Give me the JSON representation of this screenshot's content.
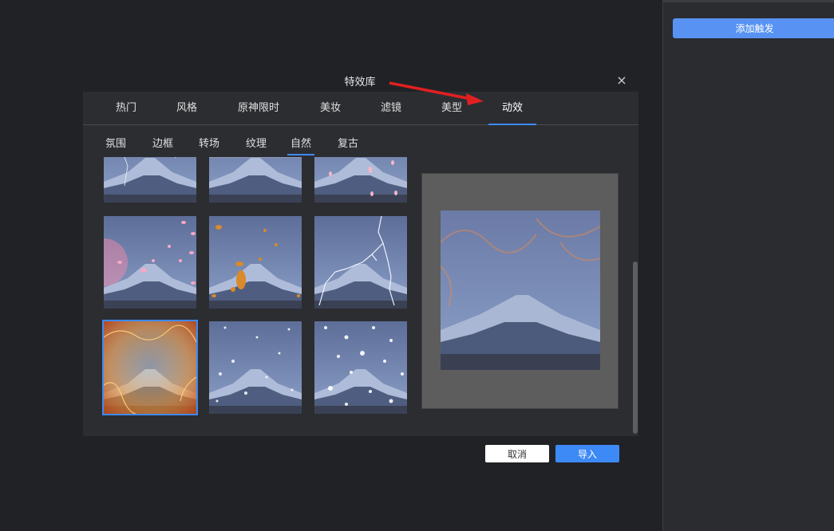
{
  "right_panel": {
    "add_trigger_label": "添加触发"
  },
  "dialog": {
    "title": "特效库",
    "close_symbol": "×",
    "tabs": [
      "热门",
      "风格",
      "原神限时",
      "美妆",
      "滤镜",
      "美型",
      "动效"
    ],
    "active_tab": "动效",
    "subtabs": [
      "氛围",
      "边框",
      "转场",
      "纹理",
      "自然",
      "复古"
    ],
    "active_subtab": "自然",
    "thumbnails": [
      {
        "effect": "lightning-rain"
      },
      {
        "effect": "plain"
      },
      {
        "effect": "petals-light"
      },
      {
        "effect": "cherry-petals"
      },
      {
        "effect": "autumn-leaves"
      },
      {
        "effect": "lightning"
      },
      {
        "effect": "fire",
        "selected": true
      },
      {
        "effect": "snow-light"
      },
      {
        "effect": "snow-heavy"
      }
    ],
    "preview_effect": "fire-glow",
    "buttons": {
      "cancel": "取消",
      "import": "导入"
    }
  },
  "colors": {
    "accent": "#3d8af7",
    "trigger_button": "#5893f3",
    "annotation_arrow": "#e02020"
  }
}
